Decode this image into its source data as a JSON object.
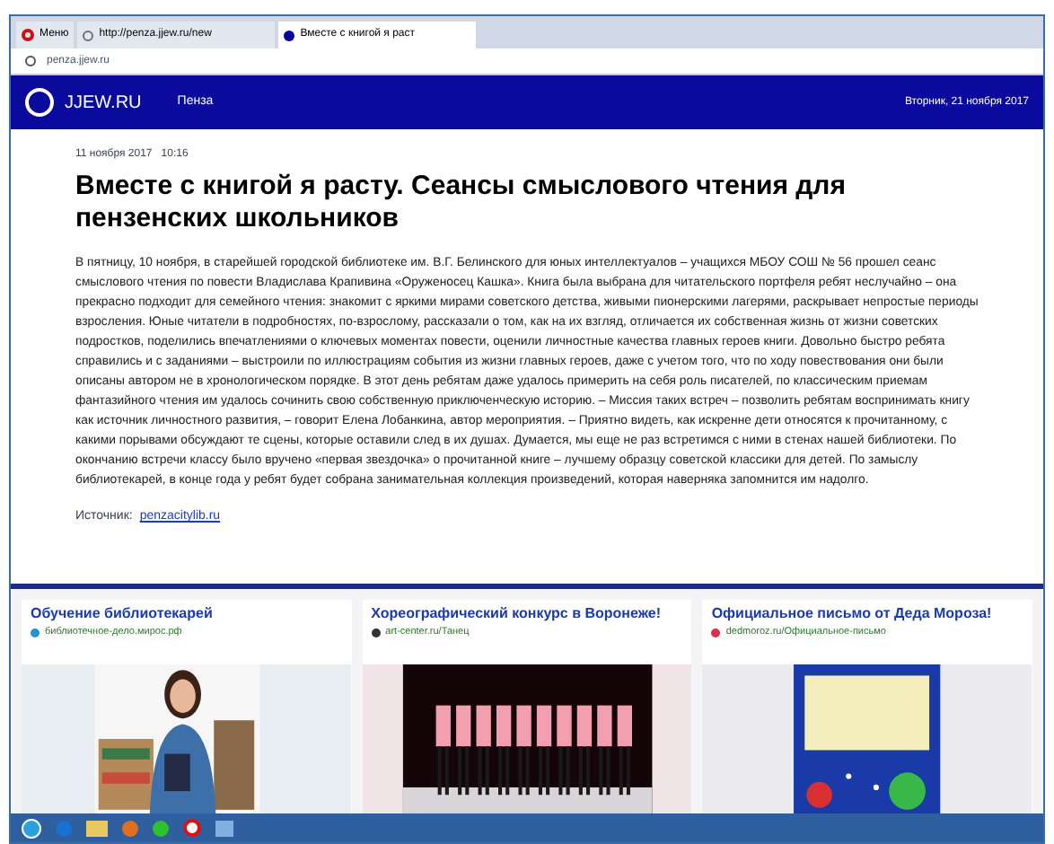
{
  "browser": {
    "tabs": [
      {
        "kind": "menu",
        "label": "Меню",
        "selected": false
      },
      {
        "kind": "page",
        "label": "http://penza.jjew.ru/new",
        "selected": false
      },
      {
        "kind": "page",
        "label": "Вместе с книгой я раст",
        "selected": true
      }
    ],
    "address": "penza.jjew.ru"
  },
  "header": {
    "logo": "JJEW.RU",
    "city": "Пенза",
    "date": "Вторник, 21 ноября 2017"
  },
  "article": {
    "datetime": "11 ноября 2017   10:16",
    "title": "Вместе с книгой я расту. Сеансы смыслового чтения для пензенских школьников",
    "body": "В пятницу, 10 ноября, в старейшей городской библиотеке им. В.Г. Белинского для юных интеллектуалов – учащихся МБОУ СОШ № 56 прошел сеанс смыслового чтения по повести Владислава Крапивина «Оруженосец Кашка». Книга была выбрана для читательского портфеля ребят неслучайно – она прекрасно подходит для семейного чтения: знакомит с яркими мирами советского детства, живыми пионерскими лагерями, раскрывает непростые периоды взросления. Юные читатели в подробностях, по-взрослому, рассказали о том, как на их взгляд, отличается их собственная жизнь от жизни советских подростков, поделились впечатлениями о ключевых моментах повести, оценили личностные качества главных героев книги. Довольно быстро ребята справились и с заданиями – выстроили по иллюстрациям события из жизни главных героев, даже с учетом того, что по ходу повествования они были описаны автором не в хронологическом порядке. В этот день ребятам даже удалось примерить на себя роль писателей, по классическим приемам фантазийного чтения им удалось сочинить свою собственную приключенческую историю. – Миссия таких встреч – позволить ребятам воспринимать книгу как источник личностного развития, – говорит Елена Лобанкина, автор мероприятия. – Приятно видеть, как искренне дети относятся к прочитанному, с какими порывами обсуждают те сцены, которые оставили след в их душах. Думается, мы еще не раз встретимся с ними в стенах нашей библиотеки. По окончанию встречи классу было вручено «первая звездочка» о прочитанной книге – лучшему образцу советской классики для детей. По замыслу библиотекарей, в конце года у ребят будет собрана занимательная коллекция произведений, которая наверняка запомнится им надолго.",
    "source_label": "Источник:",
    "source_link": "penzacitylib.ru"
  },
  "ads": [
    {
      "title": "Обучение библиотекарей",
      "site": "библиотечное-дело.мирос.рф",
      "color": "#2a8fd6",
      "kind": "picture"
    },
    {
      "title": "Хореографический конкурс в Воронеже!",
      "site": "art-center.ru/Танец",
      "color": "#333333",
      "kind": "picture"
    },
    {
      "title": "Официальное письмо от Деда Мороза!",
      "site": "dedmoroz.ru/Официальное-письмо",
      "color": "#d8324a",
      "kind": "picture"
    }
  ]
}
